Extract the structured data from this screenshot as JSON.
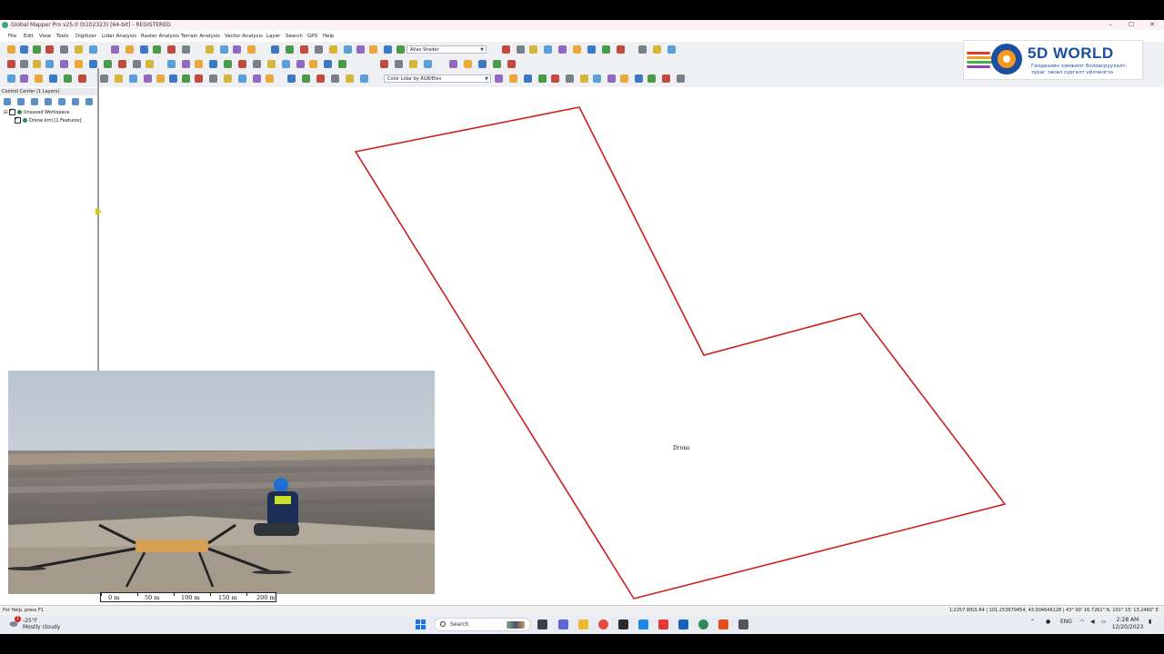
{
  "window": {
    "title": "Global Mapper Pro v25.0 (b102323) [64-bit] - REGISTERED",
    "controls": [
      "–",
      "☐",
      "✕"
    ]
  },
  "menu": [
    "File",
    "Edit",
    "View",
    "Tools",
    "Digitizer",
    "Lidar Analysis",
    "Raster Analysis",
    "Terrain Analysis",
    "Vector Analysis",
    "Layer",
    "Search",
    "GPS",
    "Help"
  ],
  "toolbar": {
    "shader_select": "Atlas Shader",
    "lidar_color_select": "Color Lidar by RGB/Elev"
  },
  "logo": {
    "brand": "5D WORLD",
    "tagline_1": "Геодезийн хэмжилт боловсруулалт,",
    "tagline_2": "зураг төсөл сургалт үйлчилгээ"
  },
  "control_center": {
    "title": "Control Center (1 Layers)",
    "workspace": "Unsaved Workspace",
    "layer": "Drone.kml [1 Features]"
  },
  "map": {
    "feature_label": "Drone",
    "scale_labels": [
      "0 m",
      "50 m",
      "100 m",
      "150 m",
      "200 m"
    ]
  },
  "colors": {
    "polygon_stroke": "#cc1f1f",
    "accent": "#1b4fa0"
  },
  "status": {
    "help": "For Help, press F1",
    "info": "1:2257  WGS 84 | 101.253679454, 43.004646128 | 43° 00' 16.7261\" N, 101° 15' 13.2460\" E"
  },
  "taskbar": {
    "temperature": "-25°F",
    "weather": "Mostly cloudy",
    "weather_badge": "1",
    "search_placeholder": "Search",
    "language": "ENG",
    "time": "2:28 AM",
    "date": "12/20/2023"
  }
}
